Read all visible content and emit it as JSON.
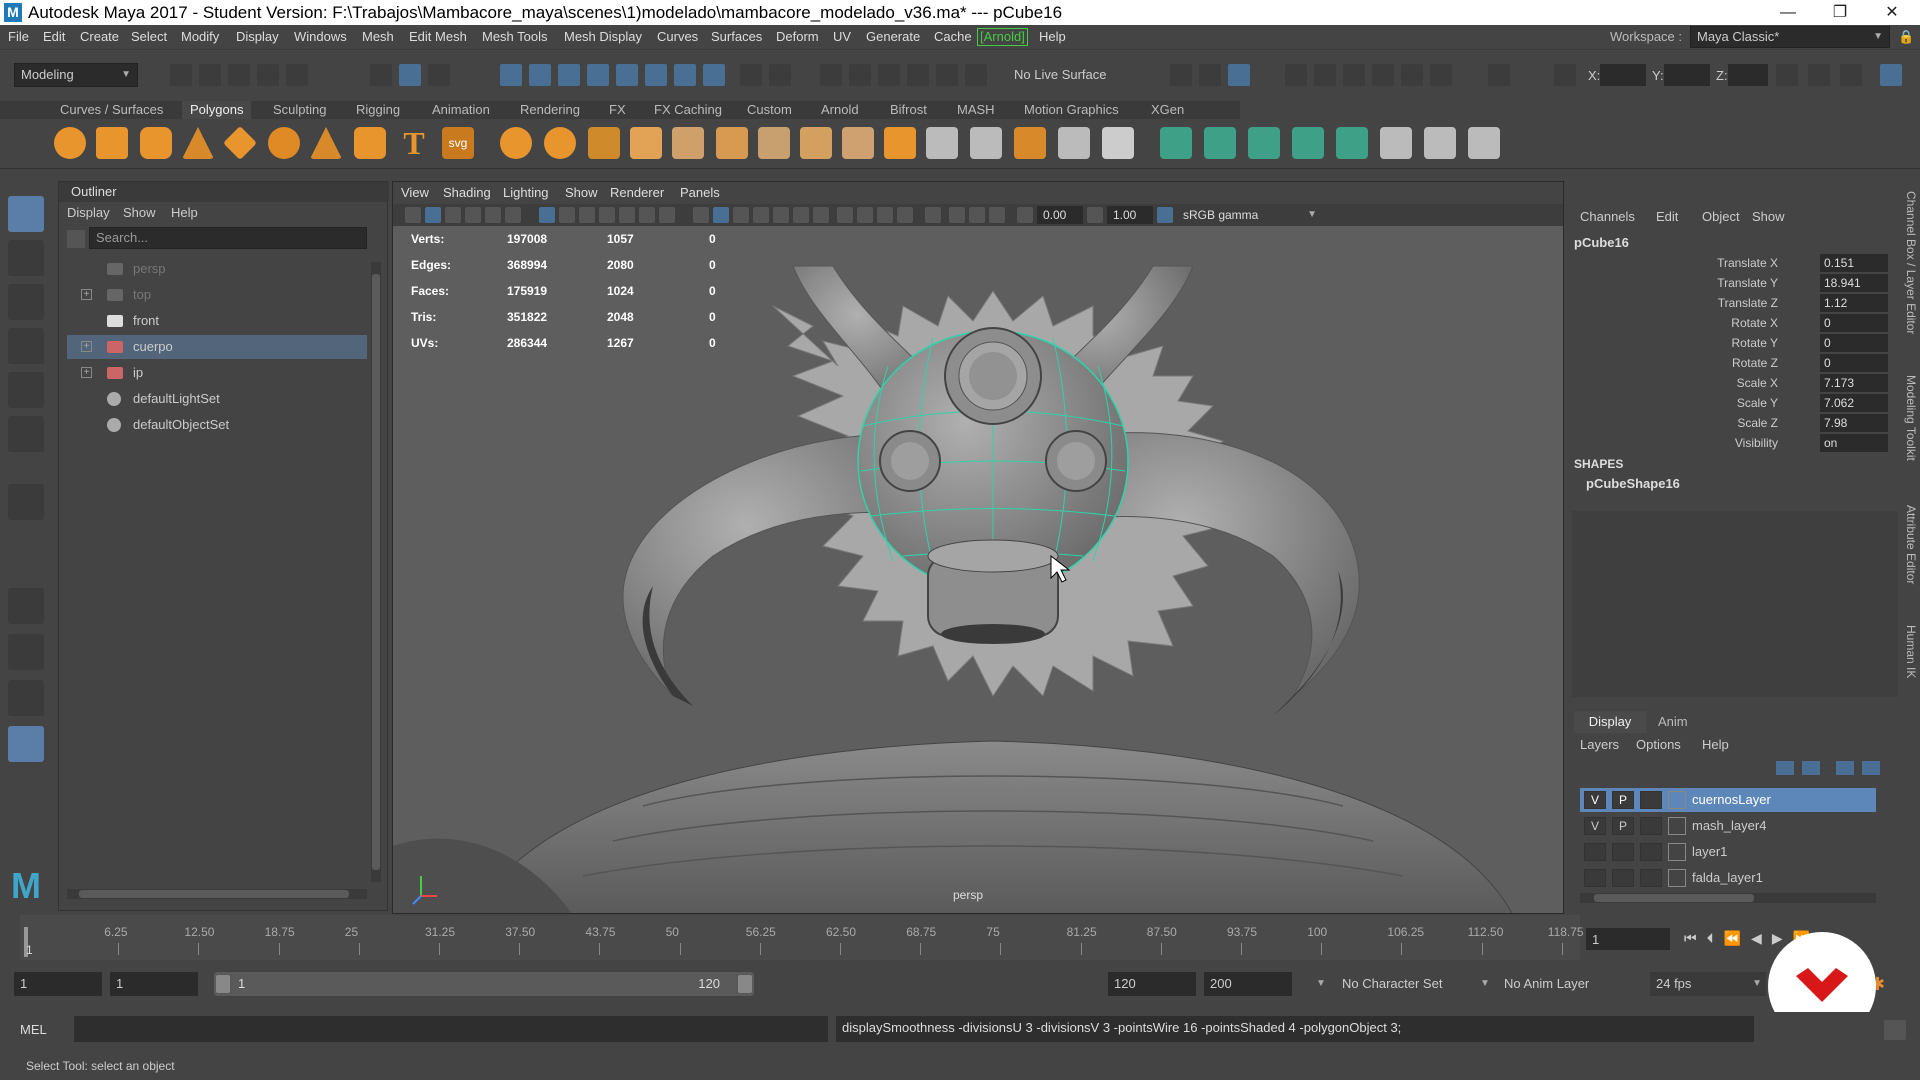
{
  "window": {
    "title": "Autodesk Maya 2017 - Student Version: F:\\Trabajos\\Mambacore_maya\\scenes\\1)modelado\\mambacore_modelado_v36.ma*  ---   pCube16",
    "logo": "M",
    "minimize": "—",
    "maximize": "❐",
    "close": "✕"
  },
  "menubar": {
    "items": [
      "File",
      "Edit",
      "Create",
      "Select",
      "Modify",
      "Display",
      "Windows",
      "Mesh",
      "Edit Mesh",
      "Mesh Tools",
      "Mesh Display",
      "Curves",
      "Surfaces",
      "Deform",
      "UV",
      "Generate",
      "Cache",
      "[Arnold]",
      "Help"
    ],
    "workspace_label": "Workspace :",
    "workspace_value": "Maya Classic*"
  },
  "statusline": {
    "menuset": "Modeling",
    "live_surface": "No Live Surface",
    "x_label": "X:",
    "y_label": "Y:",
    "z_label": "Z:"
  },
  "shelf": {
    "tabs": [
      "Curves / Surfaces",
      "Polygons",
      "Sculpting",
      "Rigging",
      "Animation",
      "Rendering",
      "FX",
      "FX Caching",
      "Custom",
      "Arnold",
      "Bifrost",
      "MASH",
      "Motion Graphics",
      "XGen"
    ],
    "active": "Polygons",
    "text_icon": "T",
    "svg_icon": "svg"
  },
  "outliner": {
    "title": "Outliner",
    "menu": [
      "Display",
      "Show",
      "Help"
    ],
    "search_placeholder": "Search...",
    "items": [
      {
        "label": "persp",
        "dim": true
      },
      {
        "label": "top",
        "dim": true
      },
      {
        "label": "front",
        "dim": false
      },
      {
        "label": "cuerpo",
        "dim": false
      },
      {
        "label": "ip",
        "dim": false
      },
      {
        "label": "defaultLightSet",
        "dim": false
      },
      {
        "label": "defaultObjectSet",
        "dim": false
      }
    ]
  },
  "viewport": {
    "menu": [
      "View",
      "Shading",
      "Lighting",
      "Show",
      "Renderer",
      "Panels"
    ],
    "field1": "0.00",
    "field2": "1.00",
    "colorspace": "sRGB gamma",
    "camera_label": "persp",
    "stats": [
      {
        "label": "Verts:",
        "a": "197008",
        "b": "1057",
        "c": "0"
      },
      {
        "label": "Edges:",
        "a": "368994",
        "b": "2080",
        "c": "0"
      },
      {
        "label": "Faces:",
        "a": "175919",
        "b": "1024",
        "c": "0"
      },
      {
        "label": "Tris:",
        "a": "351822",
        "b": "2048",
        "c": "0"
      },
      {
        "label": "UVs:",
        "a": "286344",
        "b": "1267",
        "c": "0"
      }
    ]
  },
  "channelbox": {
    "menu": [
      "Channels",
      "Edit",
      "Object",
      "Show"
    ],
    "object": "pCube16",
    "channels": [
      {
        "label": "Translate X",
        "value": "0.151"
      },
      {
        "label": "Translate Y",
        "value": "18.941"
      },
      {
        "label": "Translate Z",
        "value": "1.12"
      },
      {
        "label": "Rotate X",
        "value": "0"
      },
      {
        "label": "Rotate Y",
        "value": "0"
      },
      {
        "label": "Rotate Z",
        "value": "0"
      },
      {
        "label": "Scale X",
        "value": "7.173"
      },
      {
        "label": "Scale Y",
        "value": "7.062"
      },
      {
        "label": "Scale Z",
        "value": "7.98"
      },
      {
        "label": "Visibility",
        "value": "on"
      }
    ],
    "shapes_header": "SHAPES",
    "shape_name": "pCubeShape16",
    "side_tabs": [
      "Channel Box / Layer Editor",
      "Modeling Toolkit",
      "Attribute Editor",
      "Human IK"
    ]
  },
  "layers": {
    "tabs": [
      "Display",
      "Anim"
    ],
    "menu": [
      "Layers",
      "Options",
      "Help"
    ],
    "rows": [
      {
        "v": "V",
        "p": "P",
        "name": "cuernosLayer",
        "selected": true
      },
      {
        "v": "V",
        "p": "P",
        "name": "mash_layer4",
        "selected": false
      },
      {
        "v": "",
        "p": "",
        "name": "layer1",
        "selected": false
      },
      {
        "v": "",
        "p": "",
        "name": "falda_layer1",
        "selected": false
      }
    ]
  },
  "timeline": {
    "ticks": [
      "6.25",
      "12.50",
      "18.75",
      "25",
      "31.25",
      "37.50",
      "43.75",
      "50",
      "56.25",
      "62.50",
      "68.75",
      "75",
      "81.25",
      "87.50",
      "93.75",
      "100",
      "106.25",
      "112.50",
      "118.75"
    ],
    "current_marker": "1",
    "current_frame": "1"
  },
  "range": {
    "start": "1",
    "playback_start": "1",
    "slider_start": "1",
    "slider_end": "120",
    "playback_end": "120",
    "end": "200",
    "character_set": "No Character Set",
    "anim_layer": "No Anim Layer",
    "fps": "24 fps"
  },
  "cmdline": {
    "label": "MEL",
    "result": "displaySmoothness -divisionsU 3 -divisionsV 3 -pointsWire 16 -pointsShaded 4 -polygonObject 3;"
  },
  "helpline": "Select Tool: select an object",
  "colors": {
    "accent": "#5d87b8",
    "wire": "#2fd3a8",
    "arnold": "#4c4"
  }
}
